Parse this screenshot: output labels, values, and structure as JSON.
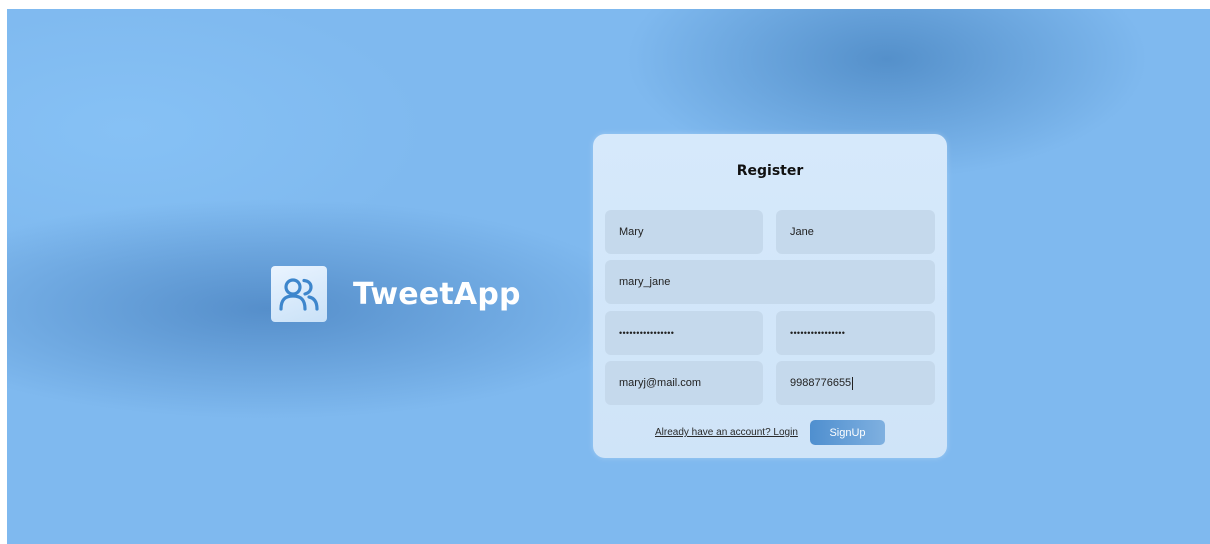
{
  "app": {
    "name": "TweetApp",
    "logo_icon": "users-icon",
    "accent_color": "#4f8fcf"
  },
  "register": {
    "title": "Register",
    "first_name": "Mary",
    "last_name": "Jane",
    "username": "mary_jane",
    "password_masked": "••••••••••••••••",
    "confirm_password_masked": "••••••••••••••••",
    "email": "maryj@mail.com",
    "phone": "9988776655",
    "login_link": "Already have an account? Login",
    "signup_label": "SignUp"
  }
}
